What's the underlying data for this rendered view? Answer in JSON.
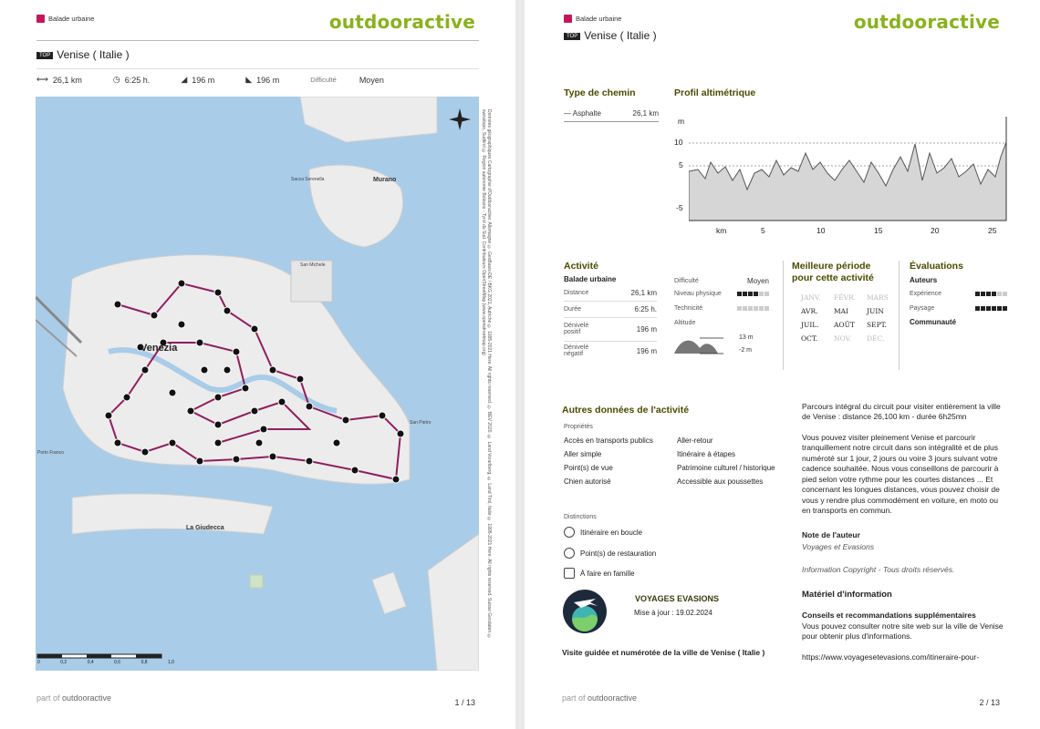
{
  "brand": "outdooractive",
  "category": "Balade urbaine",
  "top_badge": "TOP",
  "title": "Venise ( Italie )",
  "stats": {
    "distance": "26,1 km",
    "duration": "6:25 h.",
    "ascent": "196 m",
    "descent": "196 m",
    "difficulty_label": "Difficulté",
    "difficulty_value": "Moyen"
  },
  "map": {
    "labels": {
      "venezia": "Venezia",
      "murano": "Murano",
      "giudecca": "La Giudecca",
      "san_michele": "San Michele",
      "sacca_serenella": "Sacca Serenella",
      "san_pietro": "San Pietro",
      "porto_franco": "Porto Franco"
    },
    "scale": [
      "0",
      "0,2",
      "0,4",
      "0,6",
      "0,8",
      "1,0"
    ],
    "copyright": "Données géographiques Cartographie d'Outdooractive: Allemagne © GeoBasis-DE / BKG 2021, Autriche © 1995-2021 Here. All rights reserved. © BEV 2020. © Land Vorarlberg, © Land Tirol, Italie © 1995-2021 Here. All rights reserved. Suisse Geodaten © swisstopo, Sudtirol © Region autonome Bolzano - Tyrol du Sud. Contributeurs OpenStreetMap (www.openstreetmap.org)"
  },
  "footer": {
    "part_of": "part of",
    "brand": "outdooractive",
    "page1": "1 / 13",
    "page2": "2 / 13"
  },
  "page2": {
    "type_de_chemin": {
      "title": "Type de chemin",
      "label": "Asphalte",
      "value": "26,1 km"
    },
    "profil": {
      "title": "Profil altimétrique",
      "y_unit": "m",
      "y_ticks": [
        "10",
        "5",
        "-5"
      ],
      "x_unit": "km",
      "x_ticks": [
        "5",
        "10",
        "15",
        "20",
        "25"
      ]
    },
    "activite": {
      "title": "Activité",
      "subtitle": "Balade urbaine",
      "rows": [
        {
          "label": "Distance",
          "value": "26,1 km"
        },
        {
          "label": "Durée",
          "value": "6:25 h."
        },
        {
          "label": "Dénivelé positif",
          "value": "196 m"
        },
        {
          "label": "Dénivelé négatif",
          "value": "196 m"
        }
      ],
      "difficulte_label": "Difficulté",
      "difficulte_value": "Moyen",
      "niveau_label": "Niveau physique",
      "niveau_level": 4,
      "technicite_label": "Technicité",
      "technicite_level": 0,
      "altitude_label": "Altitude",
      "alt_max": "13 m",
      "alt_min": "-2 m"
    },
    "meilleure": {
      "title": "Meilleure période pour cette activité",
      "months": [
        {
          "m": "JANV.",
          "on": false
        },
        {
          "m": "FÉVR.",
          "on": false
        },
        {
          "m": "MARS",
          "on": false
        },
        {
          "m": "AVR.",
          "on": true
        },
        {
          "m": "MAI",
          "on": true
        },
        {
          "m": "JUIN",
          "on": true
        },
        {
          "m": "JUIL.",
          "on": true
        },
        {
          "m": "AOÛT",
          "on": true
        },
        {
          "m": "SEPT.",
          "on": true
        },
        {
          "m": "OCT.",
          "on": true
        },
        {
          "m": "NOV.",
          "on": false
        },
        {
          "m": "DÉC.",
          "on": false
        }
      ]
    },
    "evaluations": {
      "title": "Évaluations",
      "auteurs": "Auteurs",
      "experience": "Expérience",
      "experience_level": 4,
      "paysage": "Paysage",
      "paysage_level": 6,
      "communaute": "Communauté"
    },
    "autres": {
      "title": "Autres données de l'activité",
      "proprietes": "Propriétés",
      "props": [
        "Accès en transports publics",
        "Aller-retour",
        "Aller simple",
        "Itinéraire à étapes",
        "Point(s) de vue",
        "Patrimoine culturel / historique",
        "Chien autorisé",
        "Accessible aux poussettes"
      ],
      "distinctions": "Distinctions",
      "features": [
        "Itinéraire en boucle",
        "Point(s) de restauration",
        "À faire en famille"
      ]
    },
    "org": {
      "name": "VOYAGES EVASIONS",
      "updated": "Mise à jour : 19.02.2024",
      "route_title": "Visite guidée et numérotée de la ville de Venise ( Italie )"
    },
    "description": {
      "p1": "Parcours intégral du circuit pour visiter entièrement la ville de Venise : distance 26,100 km - durée 6h25mn",
      "p2": "Vous pouvez visiter pleinement Venise et parcourir tranquillement notre circuit dans son intégralité et de plus numéroté sur 1 jour, 2 jours ou voire 3 jours suivant votre cadence souhaitée. Nous vous conseillons de parcourir à pied selon votre rythme pour les courtes distances ... Et concernant les longues distances, vous pouvez choisir de vous y rendre plus commodément en voiture, en moto ou en transports en commun.",
      "note_title": "Note de l'auteur",
      "note_author": "Voyages et Evasions",
      "copyright": "Information Copyright - Tous droits réservés.",
      "materiel_title": "Matériel d'information",
      "conseils_title": "Conseils et recommandations supplémentaires",
      "conseils_text": "Vous pouvez consulter notre site web sur la ville de Venise pour obtenir plus d'informations.",
      "url": "https://www.voyagesetevasions.com/itineraire-pour-"
    }
  },
  "colors": {
    "brand": "#8ab11e",
    "route": "#8e1f5f",
    "water": "#a9cce8"
  }
}
